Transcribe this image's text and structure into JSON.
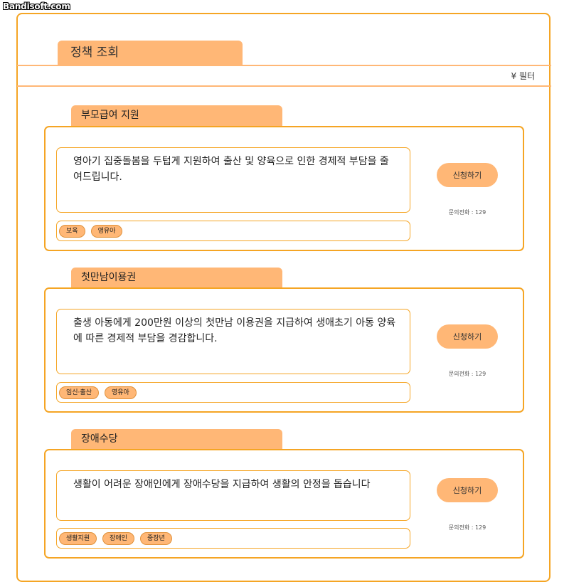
{
  "watermark": "Bandisoft.com",
  "header": {
    "title": "정책 조회"
  },
  "filter": {
    "icon": "¥",
    "label": "필터"
  },
  "policies": [
    {
      "title": "부모급여 지원",
      "description": "영아기 집중돌봄을 두텁게 지원하여 출산 및 양육으로 인한 경제적 부담을 줄여드립니다.",
      "tags": [
        "보육",
        "영유아"
      ],
      "apply_label": "신청하기",
      "phone": "문의전화 : 129"
    },
    {
      "title": "첫만남이용권",
      "description": "출생 아동에게 200만원 이상의 첫만남 이용권을 지급하여 생애초기 아동 양육에 따른 경제적 부담을 경감합니다.",
      "tags": [
        "임신·출산",
        "영유아"
      ],
      "apply_label": "신청하기",
      "phone": "문의전화 : 129"
    },
    {
      "title": "장애수당",
      "description": "생활이 어려운 장애인에게 장애수당을 지급하여 생활의 안정을 돕습니다",
      "tags": [
        "생활지원",
        "장애인",
        "중장년"
      ],
      "apply_label": "신청하기",
      "phone": "문의전화 : 129"
    }
  ],
  "colors": {
    "accent": "#ffb776",
    "border": "#f5a524"
  }
}
